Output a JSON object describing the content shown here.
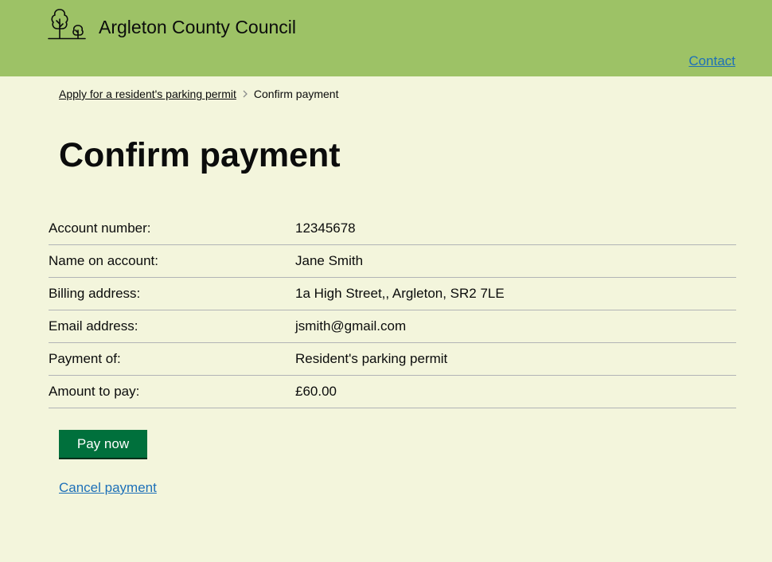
{
  "header": {
    "brand": "Argleton County Council",
    "logo_icon": "trees-icon",
    "contact_label": "Contact",
    "background_color": "#9dc266"
  },
  "breadcrumb": {
    "parent_label": "Apply for a resident's parking permit",
    "current_label": "Confirm payment",
    "separator_icon": "chevron-right-icon"
  },
  "page": {
    "title": "Confirm payment"
  },
  "summary": {
    "rows": [
      {
        "key": "Account number:",
        "value": "12345678"
      },
      {
        "key": "Name on account:",
        "value": "Jane Smith"
      },
      {
        "key": "Billing address:",
        "value": "1a High Street,, Argleton, SR2 7LE"
      },
      {
        "key": "Email address:",
        "value": "jsmith@gmail.com"
      },
      {
        "key": "Payment of:",
        "value": "Resident's parking permit"
      },
      {
        "key": "Amount to pay:",
        "value": "£60.00"
      }
    ]
  },
  "actions": {
    "pay_label": "Pay now",
    "pay_color": "#00703c",
    "cancel_label": "Cancel payment",
    "link_color": "#1d70b8"
  }
}
